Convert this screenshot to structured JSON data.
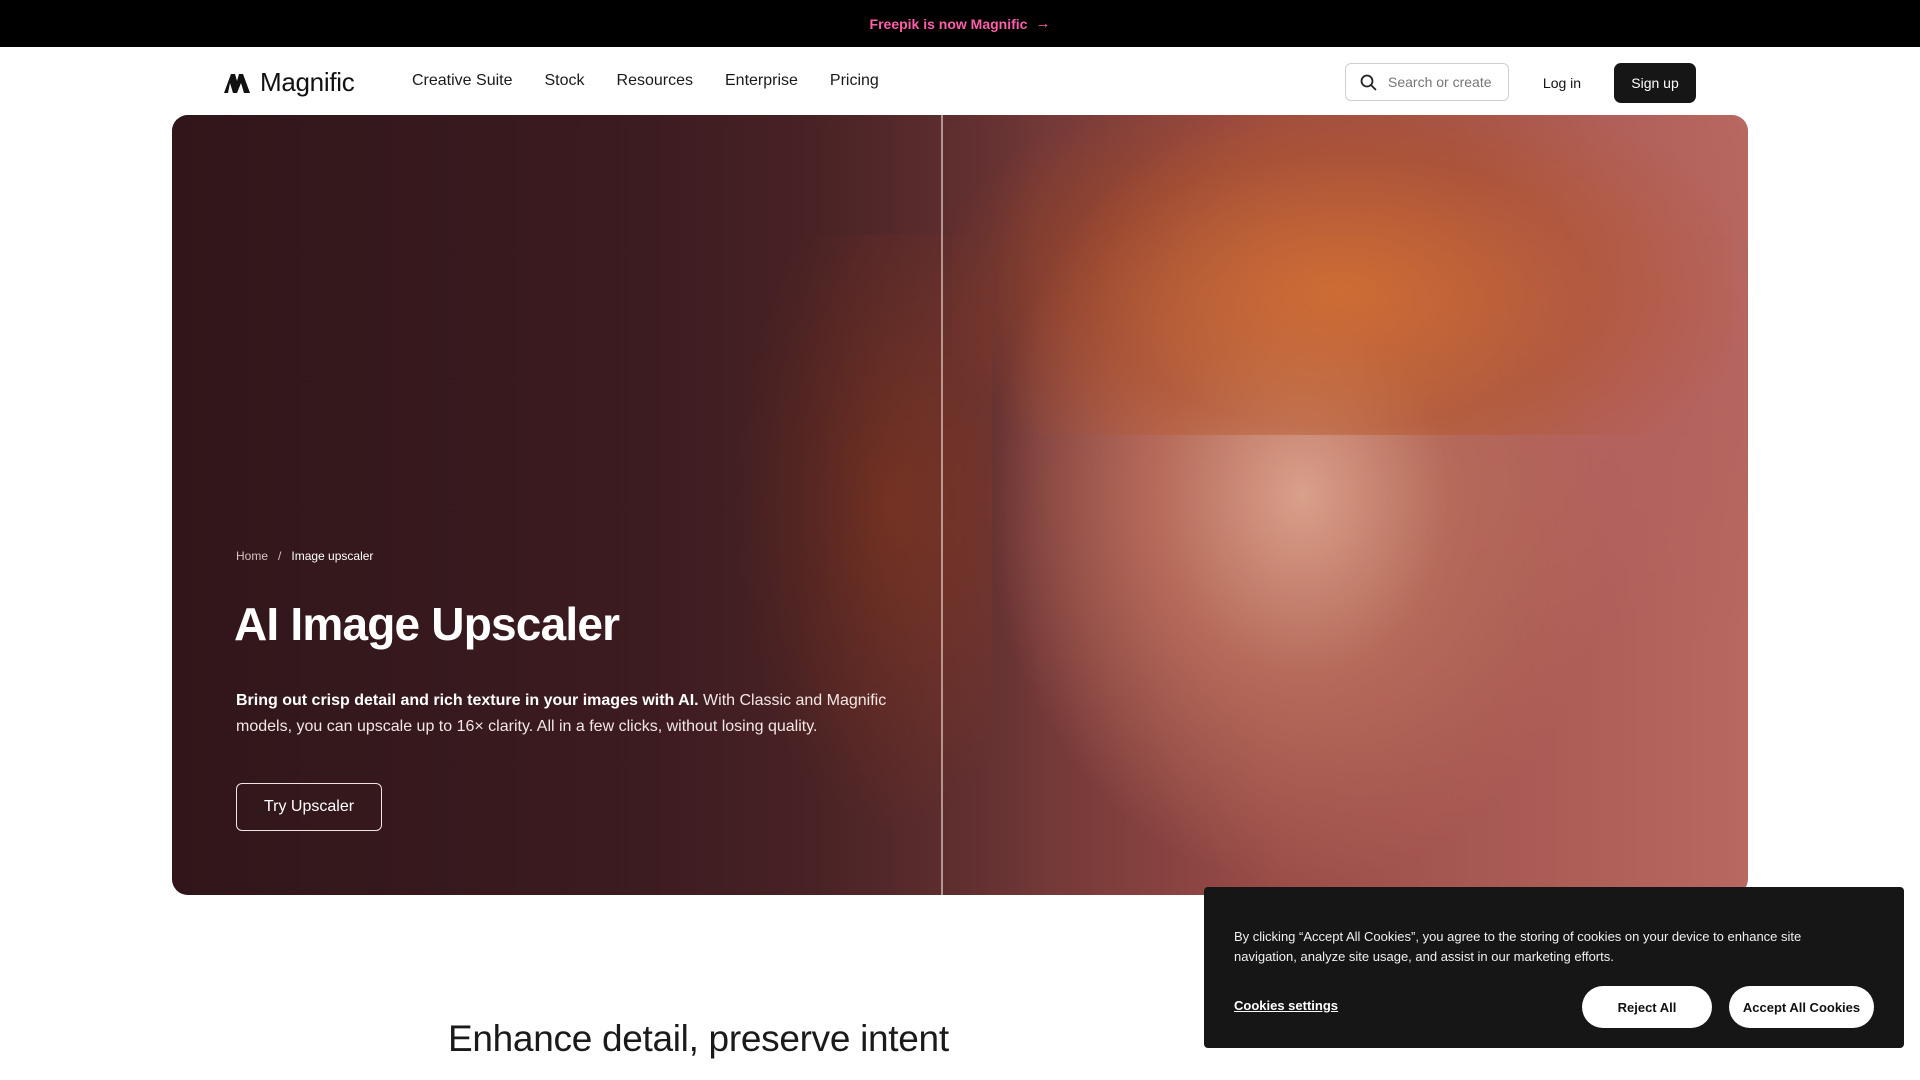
{
  "announcement": {
    "text": "Freepik is now Magnific",
    "arrow": "→"
  },
  "header": {
    "logo_text": "Magnific",
    "nav": [
      "Creative Suite",
      "Stock",
      "Resources",
      "Enterprise",
      "Pricing"
    ],
    "search_placeholder": "Search or create",
    "login_label": "Log in",
    "signup_label": "Sign up"
  },
  "hero": {
    "breadcrumb": {
      "home": "Home",
      "separator": "/",
      "current": "Image upscaler"
    },
    "title": "AI Image Upscaler",
    "description_bold": "Bring out crisp detail and rich texture in your images with AI.",
    "description_rest": " With Classic and Magnific models, you can upscale up to 16× clarity. All in a few clicks, without losing quality.",
    "cta_label": "Try Upscaler"
  },
  "section": {
    "heading": "Enhance detail, preserve intent"
  },
  "cookie_banner": {
    "text": "By clicking “Accept All Cookies”, you agree to the storing of cookies on your device to enhance site navigation, analyze site usage, and assist in our marketing efforts.",
    "settings_label": "Cookies settings",
    "reject_label": "Reject All",
    "accept_label": "Accept All Cookies"
  },
  "colors": {
    "announcement_text": "#ff5fa8",
    "signup_bg": "#161616",
    "cookie_bg": "#161616"
  },
  "icons": {
    "logo": "magnific-logo-icon",
    "search": "search-icon",
    "arrow": "arrow-right-icon"
  }
}
